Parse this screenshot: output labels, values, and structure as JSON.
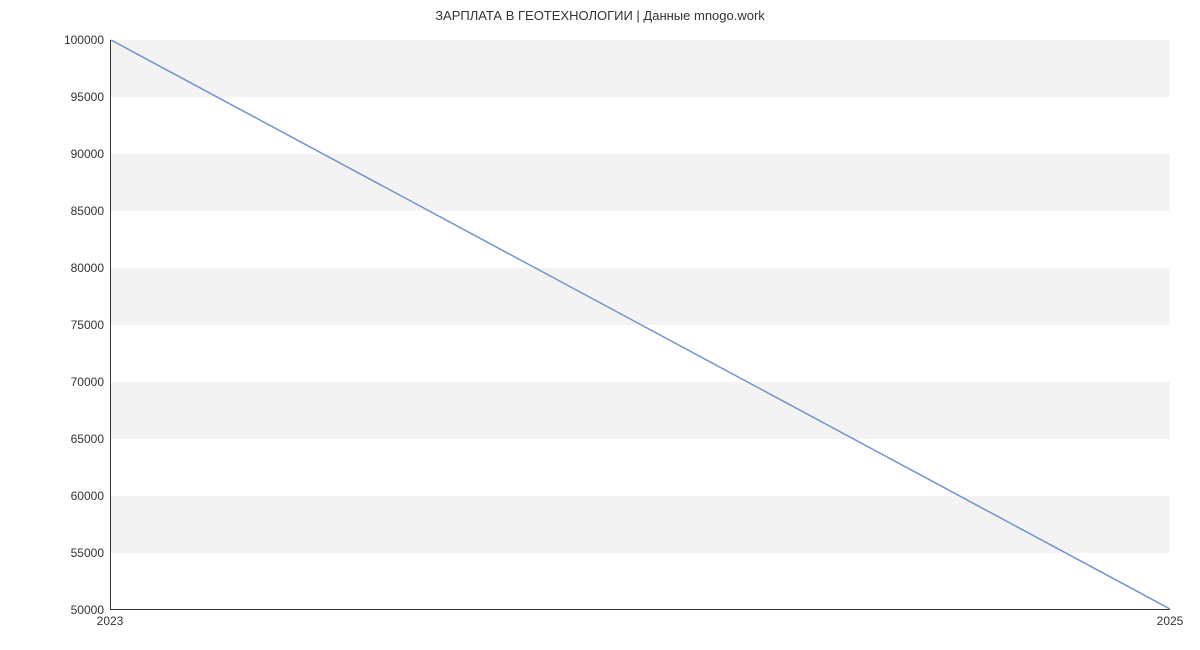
{
  "chart_data": {
    "type": "line",
    "title": "ЗАРПЛАТА В ГЕОТЕХНОЛОГИИ | Данные mnogo.work",
    "xlabel": "",
    "ylabel": "",
    "x": [
      2023,
      2025
    ],
    "values": [
      100000,
      50000
    ],
    "x_ticks": [
      2023,
      2025
    ],
    "y_ticks": [
      50000,
      55000,
      60000,
      65000,
      70000,
      75000,
      80000,
      85000,
      90000,
      95000,
      100000
    ],
    "xlim": [
      2023,
      2025
    ],
    "ylim": [
      50000,
      100000
    ],
    "line_color": "#7094d0",
    "band_color": "#f3f3f3"
  }
}
